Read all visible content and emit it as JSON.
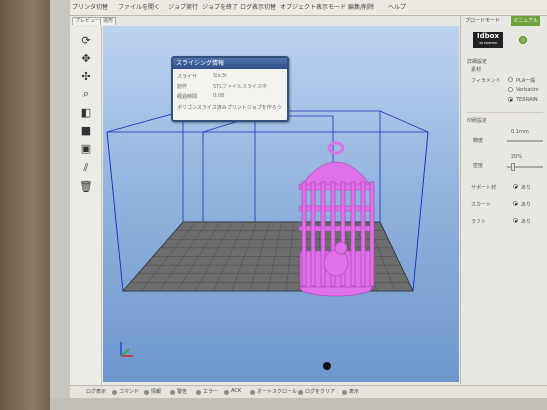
{
  "menubar": {
    "items": [
      "プリンタ切替",
      "ファイルを開く",
      "ジョブ実行",
      "ジョブを終了",
      "ログ表示切替",
      "オブジェクト表示モード",
      "編集/削除",
      "ヘルプ"
    ]
  },
  "tabs": [
    "プレビュー",
    "造形"
  ],
  "dialog": {
    "title": "スライシング情報",
    "rows": [
      {
        "label": "スライサ",
        "value": "Slic3r"
      },
      {
        "label": "創作",
        "value": "STLファイルスライス中"
      },
      {
        "label": "経過時間",
        "value": "0:08"
      }
    ],
    "footer": "ポリゴンスライス済みプリントジョブを作ろう"
  },
  "right_panel": {
    "tabs": [
      "プロードモード",
      "マニュアル"
    ],
    "logo_main": "Idbox",
    "logo_sub": "3D PRINTER",
    "material_section": "詳細設定",
    "material_label": "素材",
    "filament_label": "フィラメント",
    "filament_options": [
      "PLA一般",
      "Verbatim",
      "TERRAIN"
    ],
    "print_section": "印刷設定",
    "quality_label": "精度",
    "quality_value": "0.1mm",
    "density_label": "密度",
    "density_value": "20%",
    "support_label": "サポート材",
    "support_value": "あり",
    "skirt_label": "スカート",
    "skirt_value": "あり",
    "raft_label": "ラフト",
    "raft_value": "あり"
  },
  "statusbar": {
    "items": [
      "ログ表示",
      "コマンド",
      "情報",
      "警告",
      "エラー",
      "ACK",
      "オートスクロール",
      "ログをクリア",
      "表示"
    ]
  },
  "model_color": "#e070e8"
}
